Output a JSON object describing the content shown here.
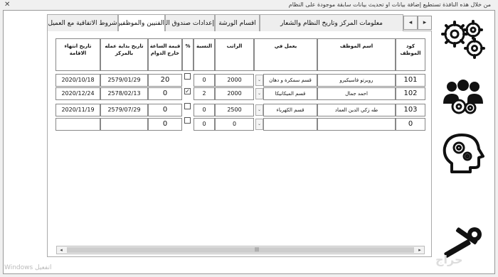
{
  "window": {
    "title": "من خلال هذه النافذة تستطيع إضافة بيانات او تحديث بيانات سابقة موجودة على النظام",
    "close_glyph": "✕"
  },
  "tabs": [
    {
      "label": "معلومات المركز وتاريخ النظام والشعار",
      "active": false
    },
    {
      "label": "اقسام الورشة",
      "active": false
    },
    {
      "label": "إعدادات صندوق المحاسبة",
      "active": false
    },
    {
      "label": "الفنيين والموظفين",
      "active": true
    },
    {
      "label": "شروط الاتفاقية مع العميل",
      "active": false
    }
  ],
  "tab_scroll": {
    "left": "◂",
    "right": "▸"
  },
  "table": {
    "headers": {
      "code": "كود الموظف",
      "name": "اسم الموظف",
      "works_in": "يعمل في",
      "salary": "الراتب",
      "percent": "النسبة",
      "pct_flag": "%",
      "overtime": "قيمة الساعة خارج الدوام",
      "start_date": "تاريخ بداية عمله بالمركز",
      "residency_end": "تاريخ انتهاء الاقامة"
    },
    "rows": [
      {
        "code": "101",
        "name": "روبرتو فاسيكيرو",
        "works_in": "قسم سمكرة و دهان",
        "salary": "2000",
        "percent": "0",
        "checked": false,
        "overtime": "20",
        "start_date": "2579/01/29",
        "residency_end": "2020/10/18"
      },
      {
        "code": "102",
        "name": "احمد جمال",
        "works_in": "قسم الميكانيكا",
        "salary": "2000",
        "percent": "2",
        "checked": true,
        "overtime": "0",
        "start_date": "2578/02/13",
        "residency_end": "2020/12/24"
      },
      {
        "code": "103",
        "name": "طه زكي الدين العماد",
        "works_in": "قسم الكهرباء",
        "salary": "2500",
        "percent": "0",
        "checked": false,
        "overtime": "0",
        "start_date": "2579/07/29",
        "residency_end": "2020/11/19"
      },
      {
        "code": "0",
        "name": "",
        "works_in": "",
        "salary": "0",
        "percent": "0",
        "checked": false,
        "overtime": "0",
        "start_date": "",
        "residency_end": ""
      }
    ],
    "dropdown_glyph": "⌄",
    "check_glyph": "✓"
  },
  "hscroll": {
    "left": "◂",
    "right": "▸",
    "grip": "|||"
  },
  "sidebar": {
    "items": [
      {
        "icon": "gears-icon"
      },
      {
        "icon": "team-settings-icon"
      },
      {
        "icon": "head-gear-icon"
      },
      {
        "icon": "tools-icon"
      }
    ]
  },
  "watermark": "Windows اتفعيل",
  "brand": "حراج"
}
